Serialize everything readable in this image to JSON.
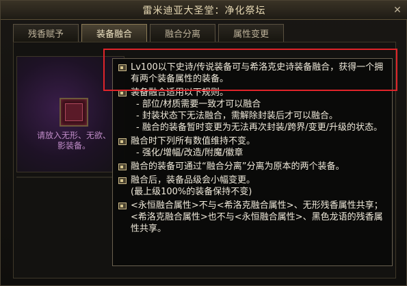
{
  "window": {
    "title": "雷米迪亚大圣堂：净化祭坛",
    "close_label": "✕"
  },
  "tabs": [
    {
      "label": "残香赋予",
      "active": false
    },
    {
      "label": "装备融合",
      "active": true
    },
    {
      "label": "融合分离",
      "active": false
    },
    {
      "label": "属性变更",
      "active": false
    }
  ],
  "left_panel": {
    "slot_hint_line1": "请放入无形、无欲、",
    "slot_hint_line2": "影装备。"
  },
  "tooltip": {
    "item1": "Lv100以下史诗/传说装备可与希洛克史诗装备融合，获得一个拥有两个装备属性的装备。",
    "item2_title": "装备融合适用以下规则。",
    "item2_sub1": "- 部位/材质需要一致才可以融合",
    "item2_sub2": "- 封装状态下无法融合，需解除封装后才可以融合。",
    "item2_sub3": "- 融合的装备暂时变更为无法再次封装/跨界/变更/升级的状态。",
    "item3_title": "融合时下列所有数值维持不变。",
    "item3_sub1": "- 强化/增幅/改造/附魔/徽章",
    "item4": "融合的装备可通过“融合分离”分离为原本的两个装备。",
    "item5_line1": "融合后，装备品级会小幅变更。",
    "item5_line2": "(最上级100%的装备保持不变)",
    "item6": "<永恒融合属性>不与<希洛克融合属性>、无形残香属性共享；<希洛克融合属性>也不与<永恒融合属性>、黑色龙语的残香属性共享。"
  },
  "colors": {
    "highlight_border": "#e0242a",
    "hint_text": "#c08cc8"
  }
}
